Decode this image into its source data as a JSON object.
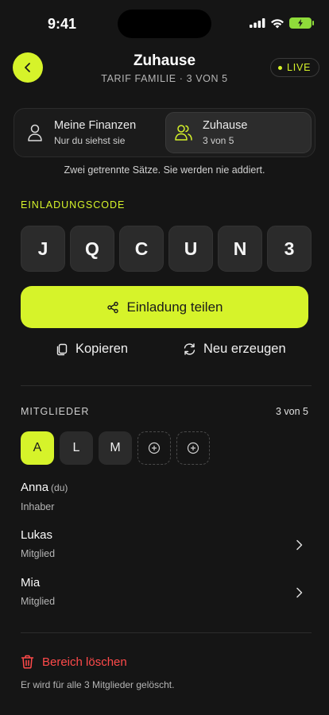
{
  "status": {
    "time": "9:41"
  },
  "header": {
    "title": "Zuhause",
    "subtitle": "TARIF FAMILIE · 3 VON 5",
    "live_label": "LIVE"
  },
  "segment": {
    "items": [
      {
        "label": "Meine Finanzen",
        "sub": "Nur du siehst sie",
        "icon": "person-icon"
      },
      {
        "label": "Zuhause",
        "sub": "3 von 5",
        "icon": "people-icon",
        "selected": true
      }
    ],
    "note": "Zwei getrennte Sätze. Sie werden nie addiert."
  },
  "invite": {
    "label": "EINLADUNGSCODE",
    "code": [
      "J",
      "Q",
      "C",
      "U",
      "N",
      "3"
    ],
    "share_label": "Einladung teilen",
    "copy_label": "Kopieren",
    "regenerate_label": "Neu erzeugen"
  },
  "members": {
    "label": "MITGLIEDER",
    "count": "3 von 5",
    "avatars": [
      "A",
      "L",
      "M"
    ],
    "list": [
      {
        "name": "Anna",
        "tag": "(du)",
        "role": "Inhaber"
      },
      {
        "name": "Lukas",
        "role": "Mitglied"
      },
      {
        "name": "Mia",
        "role": "Mitglied"
      }
    ]
  },
  "danger": {
    "delete_label": "Bereich löschen",
    "delete_note": "Er wird für alle 3 Mitglieder gelöscht."
  },
  "colors": {
    "background": "#151515",
    "accent": "#d6f32a",
    "danger": "#ff4a4a",
    "battery": "#8fdc3a"
  }
}
